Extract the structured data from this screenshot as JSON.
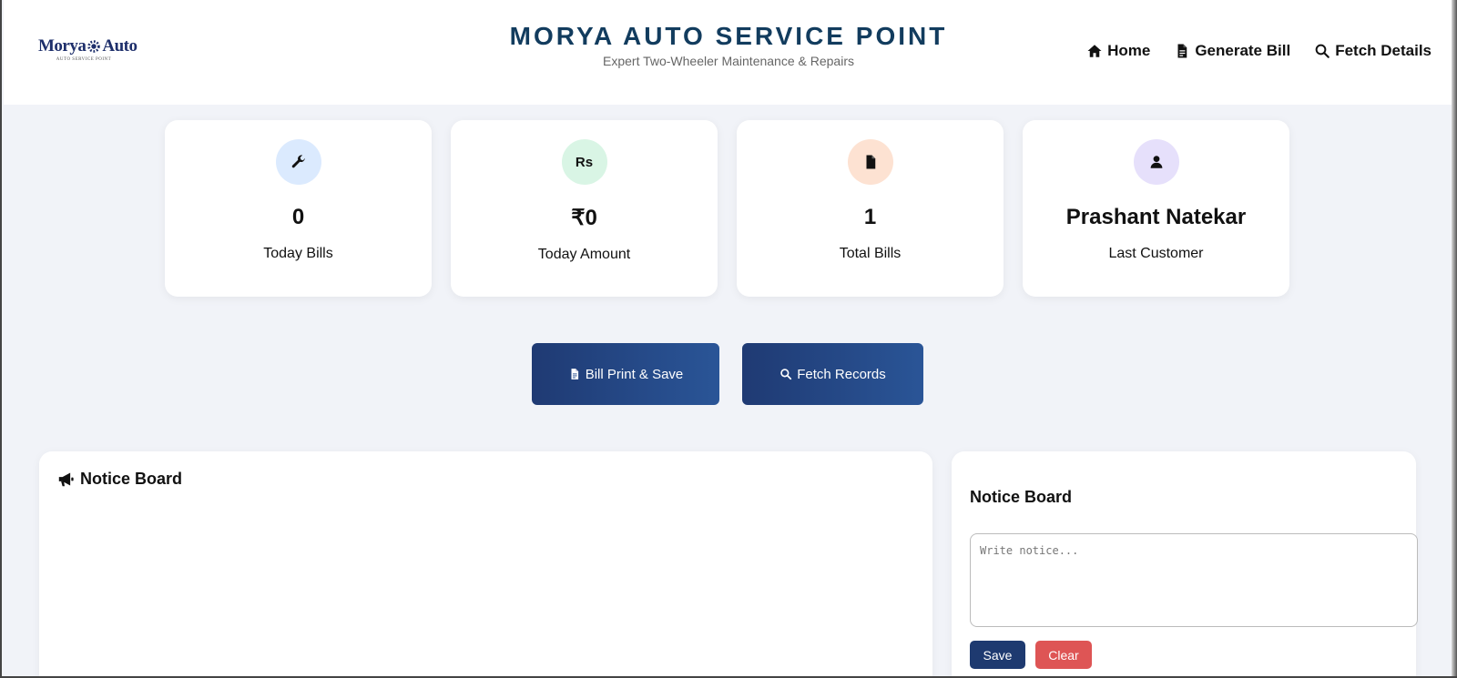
{
  "header": {
    "logo_text_left": "Morya",
    "logo_text_right": "Auto",
    "logo_subtext": "AUTO SERVICE POINT",
    "title": "MORYA AUTO SERVICE POINT",
    "subtitle": "Expert Two-Wheeler Maintenance & Repairs"
  },
  "nav": {
    "items": [
      {
        "label": "Home",
        "icon": "home-icon"
      },
      {
        "label": "Generate Bill",
        "icon": "file-icon"
      },
      {
        "label": "Fetch Details",
        "icon": "search-icon"
      }
    ]
  },
  "stats": [
    {
      "icon": "wrench-icon",
      "icon_glyph": "wrench",
      "icon_bg": "#dbeafe",
      "value": "0",
      "label": "Today Bills"
    },
    {
      "icon": "rupee-icon",
      "icon_glyph": "Rs",
      "icon_bg": "#d9f5e5",
      "value": "₹0",
      "label": "Today Amount"
    },
    {
      "icon": "file-icon",
      "icon_glyph": "file",
      "icon_bg": "#fde2d2",
      "value": "1",
      "label": "Total Bills"
    },
    {
      "icon": "user-icon",
      "icon_glyph": "user",
      "icon_bg": "#e6e0fb",
      "value": "Prashant Natekar",
      "label": "Last Customer"
    }
  ],
  "actions": {
    "print_label": "Bill Print & Save",
    "fetch_label": "Fetch Records"
  },
  "notice_main": {
    "title": "Notice Board"
  },
  "notice_side": {
    "title": "Notice Board",
    "placeholder": "Write notice...",
    "save_label": "Save",
    "clear_label": "Clear"
  },
  "colors": {
    "brand_title": "#123c5e",
    "primary_button": "#1f3a73",
    "save_button": "#1e3a70",
    "clear_button": "#de5555",
    "page_bg": "#f1f3f8"
  }
}
